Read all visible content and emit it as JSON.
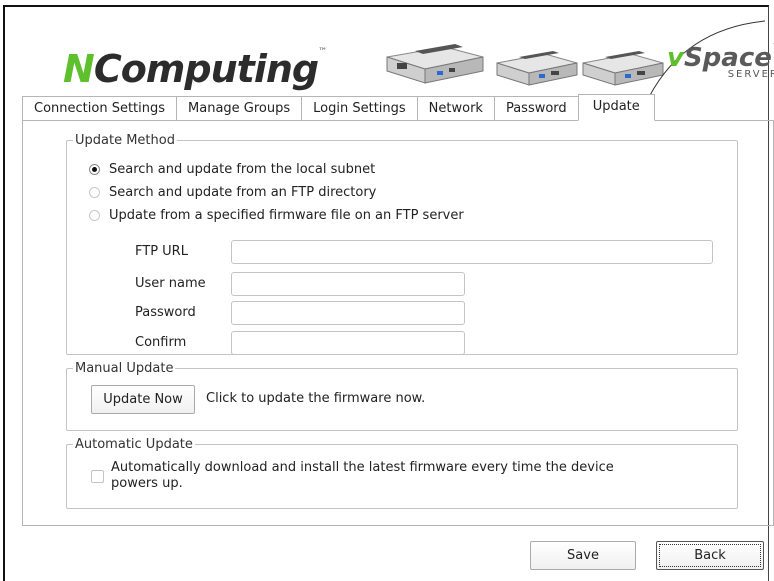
{
  "brand": {
    "logo_n": "N",
    "logo_rest": "Computing",
    "logo_tm": "™",
    "product_v": "v",
    "product_rest": "Space",
    "product_tm": "™",
    "product_sub": "SERVER",
    "accent_color": "#5fc02e"
  },
  "tabs": [
    {
      "label": "Connection Settings",
      "active": false
    },
    {
      "label": "Manage Groups",
      "active": false
    },
    {
      "label": "Login Settings",
      "active": false
    },
    {
      "label": "Network",
      "active": false
    },
    {
      "label": "Password",
      "active": false
    },
    {
      "label": "Update",
      "active": true
    }
  ],
  "update_method": {
    "legend": "Update Method",
    "options": [
      {
        "label": "Search and update from the local subnet",
        "selected": true
      },
      {
        "label": "Search and update from an FTP directory",
        "selected": false
      },
      {
        "label": "Update from a specified firmware file on an FTP server",
        "selected": false
      }
    ],
    "fields": {
      "ftp_url": {
        "label": "FTP URL",
        "value": ""
      },
      "user_name": {
        "label": "User name",
        "value": ""
      },
      "password": {
        "label": "Password",
        "value": ""
      },
      "confirm": {
        "label": "Confirm",
        "value": ""
      }
    }
  },
  "manual_update": {
    "legend": "Manual Update",
    "button_label": "Update Now",
    "description": "Click to update the firmware now."
  },
  "automatic_update": {
    "legend": "Automatic Update",
    "checkbox_label_line1": "Automatically download and install the latest firmware every time the device",
    "checkbox_label_line2": "powers up.",
    "checked": false
  },
  "footer": {
    "save_label": "Save",
    "back_label": "Back"
  }
}
